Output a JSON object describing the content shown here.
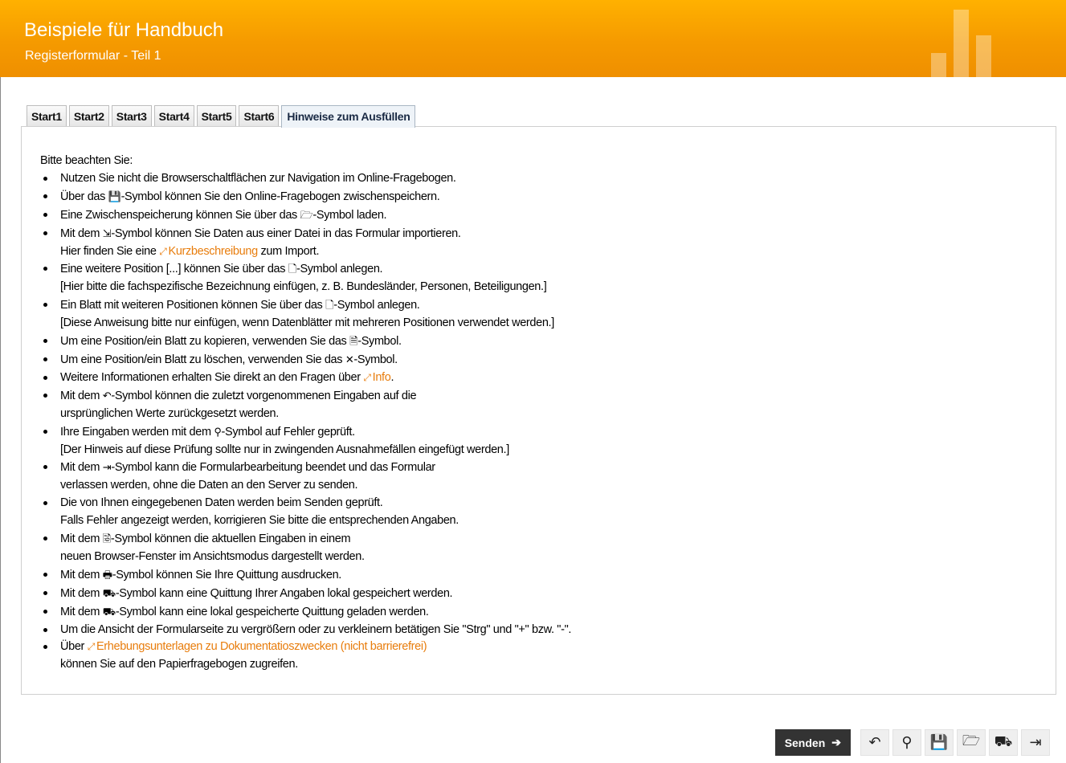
{
  "header": {
    "title": "Beispiele für Handbuch",
    "subtitle": "Registerformular - Teil 1"
  },
  "tabs": [
    {
      "label": "Start1"
    },
    {
      "label": "Start2"
    },
    {
      "label": "Start3"
    },
    {
      "label": "Start4"
    },
    {
      "label": "Start5"
    },
    {
      "label": "Start6"
    },
    {
      "label": "Hinweise zum Ausfüllen",
      "active": true
    }
  ],
  "content": {
    "intro": "Bitte beachten Sie:",
    "items": [
      {
        "text": "Nutzen Sie nicht die Browserschaltflächen zur Navigation im Online-Fragebogen."
      },
      {
        "pre": "Über das ",
        "icon": "💾",
        "post": "-Symbol können Sie den Online-Fragebogen zwischenspeichern."
      },
      {
        "pre": "Eine Zwischenspeicherung können Sie über das ",
        "icon": "🗁",
        "post": "-Symbol laden."
      },
      {
        "pre": "Mit dem ",
        "icon": "⇲",
        "post": "-Symbol können Sie Daten aus einer Datei in das Formular importieren.",
        "l2_pre": "Hier finden Sie eine ",
        "l2_link": "Kurzbeschreibung",
        "l2_post": " zum Import."
      },
      {
        "pre": "Eine weitere Position [...] können Sie über das ",
        "icon": "🗋",
        "post": "-Symbol anlegen.",
        "line2": "[Hier bitte die fachspezifische Bezeichnung einfügen, z. B. Bundesländer, Personen, Beteiligungen.]"
      },
      {
        "pre": "Ein Blatt mit weiteren Positionen können Sie über das ",
        "icon": "🗋",
        "post": "-Symbol anlegen.",
        "line2": "[Diese Anweisung bitte nur einfügen, wenn Datenblätter mit mehreren Positionen verwendet werden.]"
      },
      {
        "pre": "Um eine Position/ein Blatt zu kopieren, verwenden Sie das ",
        "icon": "🗎",
        "post": "-Symbol."
      },
      {
        "pre": "Um eine Position/ein Blatt zu löschen, verwenden Sie das ",
        "icon": "✕",
        "post": "-Symbol."
      },
      {
        "pre": "Weitere Informationen erhalten Sie direkt an den Fragen über ",
        "link": "Info",
        "post": "."
      },
      {
        "pre": "Mit dem ",
        "icon": "↶",
        "post": "-Symbol können die zuletzt vorgenommenen Eingaben auf die",
        "line2": "ursprünglichen Werte zurückgesetzt werden."
      },
      {
        "pre": "Ihre Eingaben werden mit dem ",
        "icon": "⚲",
        "post": "-Symbol auf Fehler geprüft.",
        "line2": "[Der Hinweis auf diese Prüfung sollte nur in zwingenden Ausnahmefällen eingefügt werden.]"
      },
      {
        "pre": "Mit dem ",
        "icon": "⇥",
        "post": "-Symbol kann die Formularbearbeitung beendet und das Formular",
        "line2": "verlassen werden, ohne die Daten an den Server zu senden."
      },
      {
        "text": "Die von Ihnen eingegebenen Daten werden beim Senden geprüft.",
        "line2": "Falls Fehler angezeigt werden, korrigieren Sie bitte die entsprechenden Angaben."
      },
      {
        "pre": "Mit dem ",
        "icon": "🗟",
        "post": "-Symbol können die aktuellen Eingaben in einem",
        "line2": "neuen Browser-Fenster im Ansichtsmodus dargestellt werden."
      },
      {
        "pre": "Mit dem ",
        "icon": "🖶",
        "post": "-Symbol können Sie Ihre Quittung ausdrucken."
      },
      {
        "pre": "Mit dem ",
        "icon": "⛟",
        "post": "-Symbol kann eine Quittung Ihrer Angaben lokal gespeichert werden."
      },
      {
        "pre": "Mit dem ",
        "icon": "⛟",
        "post": "-Symbol kann eine lokal gespeicherte Quittung geladen werden."
      },
      {
        "text": "Um die Ansicht der Formularseite zu vergrößern oder zu verkleinern betätigen Sie \"Strg\" und \"+\" bzw. \"-\"."
      },
      {
        "pre": "Über ",
        "link": "Erhebungsunterlagen zu Dokumentatioszwecken (nicht barrierefrei)",
        "post": "",
        "line2": "können Sie auf den Papierfragebogen zugreifen."
      }
    ]
  },
  "footer": {
    "send_label": "Senden",
    "send_icon": "➔",
    "buttons": [
      {
        "name": "reset-button",
        "icon": "↶"
      },
      {
        "name": "check-button",
        "icon": "⚲"
      },
      {
        "name": "save-button",
        "icon": "💾"
      },
      {
        "name": "load-button",
        "icon": "🗁"
      },
      {
        "name": "receipt-button",
        "icon": "⛟"
      },
      {
        "name": "exit-button",
        "icon": "⇥"
      }
    ]
  },
  "colors": {
    "header": "#f59a00",
    "link": "#e87d0d"
  }
}
